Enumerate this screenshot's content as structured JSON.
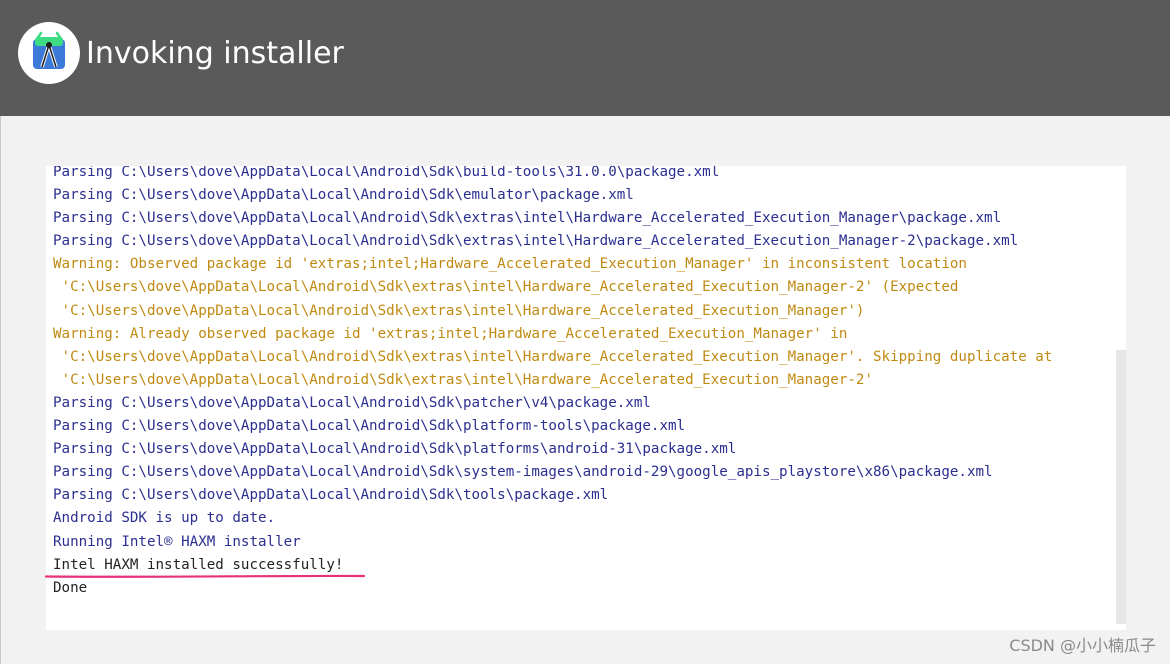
{
  "window": {
    "title": "Invoking installer",
    "logo_icon": "android-studio-icon"
  },
  "console": {
    "lines": [
      {
        "type": "info",
        "text": "Parsing C:\\Users\\dove\\AppData\\Local\\Android\\Sdk\\build-tools\\31.0.0\\package.xml"
      },
      {
        "type": "info",
        "text": "Parsing C:\\Users\\dove\\AppData\\Local\\Android\\Sdk\\emulator\\package.xml"
      },
      {
        "type": "info",
        "text": "Parsing C:\\Users\\dove\\AppData\\Local\\Android\\Sdk\\extras\\intel\\Hardware_Accelerated_Execution_Manager\\package.xml"
      },
      {
        "type": "info",
        "text": "Parsing C:\\Users\\dove\\AppData\\Local\\Android\\Sdk\\extras\\intel\\Hardware_Accelerated_Execution_Manager-2\\package.xml"
      },
      {
        "type": "warn",
        "text": "Warning: Observed package id 'extras;intel;Hardware_Accelerated_Execution_Manager' in inconsistent location"
      },
      {
        "type": "warn",
        "text": " 'C:\\Users\\dove\\AppData\\Local\\Android\\Sdk\\extras\\intel\\Hardware_Accelerated_Execution_Manager-2' (Expected"
      },
      {
        "type": "warn",
        "text": " 'C:\\Users\\dove\\AppData\\Local\\Android\\Sdk\\extras\\intel\\Hardware_Accelerated_Execution_Manager')"
      },
      {
        "type": "warn",
        "text": "Warning: Already observed package id 'extras;intel;Hardware_Accelerated_Execution_Manager' in"
      },
      {
        "type": "warn",
        "text": " 'C:\\Users\\dove\\AppData\\Local\\Android\\Sdk\\extras\\intel\\Hardware_Accelerated_Execution_Manager'. Skipping duplicate at"
      },
      {
        "type": "warn",
        "text": " 'C:\\Users\\dove\\AppData\\Local\\Android\\Sdk\\extras\\intel\\Hardware_Accelerated_Execution_Manager-2'"
      },
      {
        "type": "info",
        "text": "Parsing C:\\Users\\dove\\AppData\\Local\\Android\\Sdk\\patcher\\v4\\package.xml"
      },
      {
        "type": "info",
        "text": "Parsing C:\\Users\\dove\\AppData\\Local\\Android\\Sdk\\platform-tools\\package.xml"
      },
      {
        "type": "info",
        "text": "Parsing C:\\Users\\dove\\AppData\\Local\\Android\\Sdk\\platforms\\android-31\\package.xml"
      },
      {
        "type": "info",
        "text": "Parsing C:\\Users\\dove\\AppData\\Local\\Android\\Sdk\\system-images\\android-29\\google_apis_playstore\\x86\\package.xml"
      },
      {
        "type": "info",
        "text": "Parsing C:\\Users\\dove\\AppData\\Local\\Android\\Sdk\\tools\\package.xml"
      },
      {
        "type": "info",
        "text": "Android SDK is up to date."
      },
      {
        "type": "info",
        "text": "Running Intel® HAXM installer"
      },
      {
        "type": "plain",
        "text": "Intel HAXM installed successfully!"
      },
      {
        "type": "plain",
        "text": "Done"
      }
    ]
  },
  "annotation": {
    "underline_color": "#e8307a"
  },
  "watermark": "CSDN @小小楠瓜子",
  "colors": {
    "header_bg": "#5a5a5a",
    "info_text": "#2b2f8f",
    "warning_text": "#c08a12",
    "plain_text": "#222222"
  }
}
